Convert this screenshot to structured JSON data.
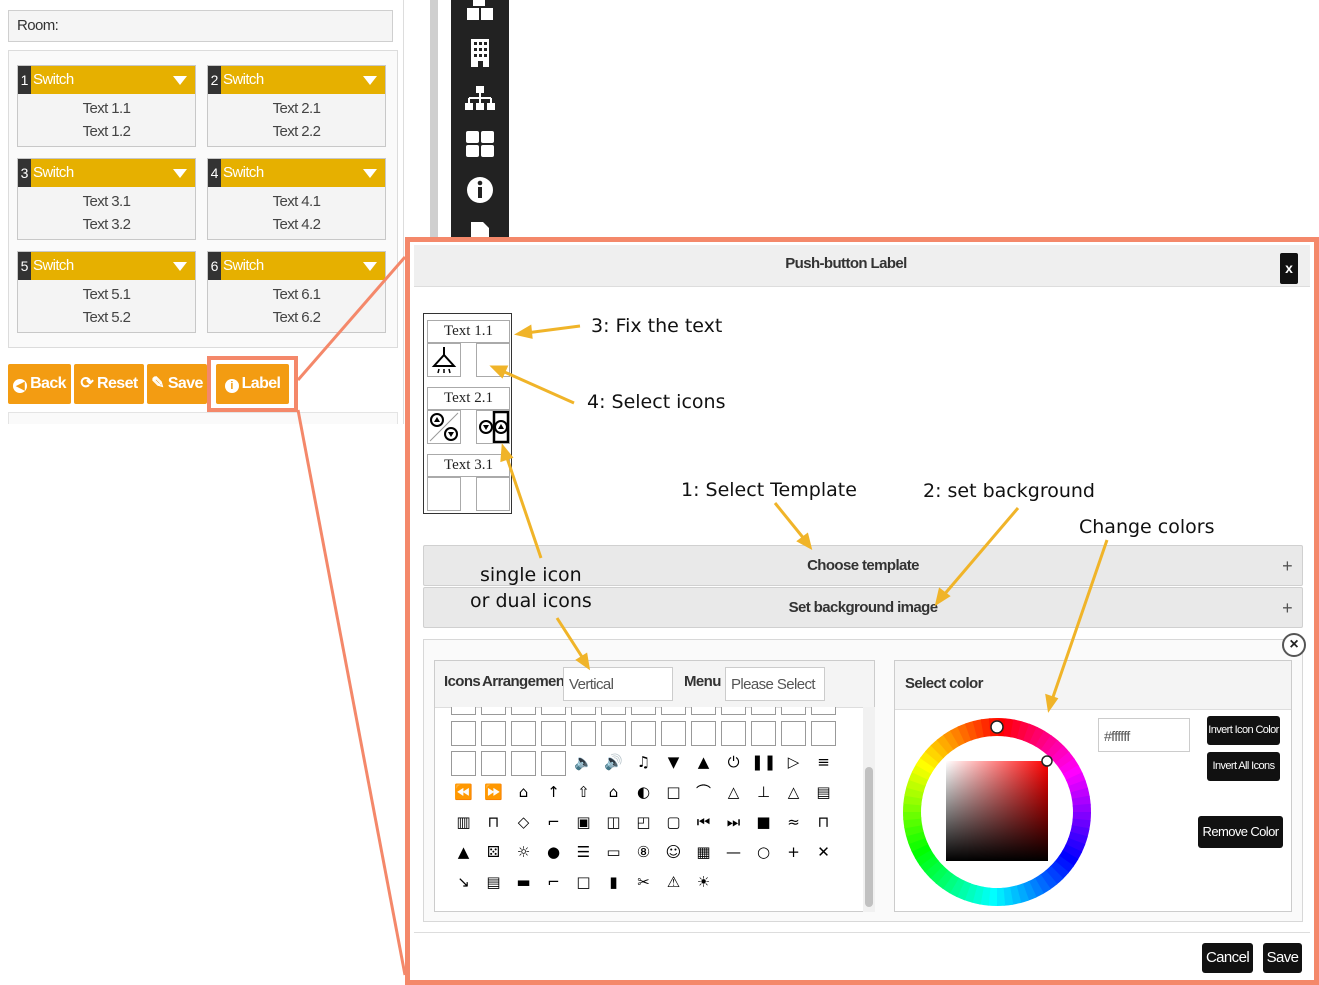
{
  "left": {
    "room_label": "Room:",
    "switches": [
      {
        "num": "1",
        "title": "Switch",
        "t1": "Text 1.1",
        "t2": "Text 1.2"
      },
      {
        "num": "2",
        "title": "Switch",
        "t1": "Text 2.1",
        "t2": "Text 2.2"
      },
      {
        "num": "3",
        "title": "Switch",
        "t1": "Text 3.1",
        "t2": "Text 3.2"
      },
      {
        "num": "4",
        "title": "Switch",
        "t1": "Text 4.1",
        "t2": "Text 4.2"
      },
      {
        "num": "5",
        "title": "Switch",
        "t1": "Text 5.1",
        "t2": "Text 5.2"
      },
      {
        "num": "6",
        "title": "Switch",
        "t1": "Text 6.1",
        "t2": "Text 6.2"
      }
    ],
    "buttons": {
      "back": "Back",
      "reset": "Reset",
      "save": "Save",
      "label": "Label"
    }
  },
  "toolbar_icons": [
    "cubes-icon",
    "building-icon",
    "sitemap-icon",
    "grid-icon",
    "info-icon",
    "file-icon"
  ],
  "dialog": {
    "title": "Push-button Label",
    "close": "x",
    "preview_texts": [
      "Text 1.1",
      "Text 2.1",
      "Text 3.1"
    ],
    "choose_template": "Choose template",
    "set_background": "Set background image",
    "icons_label": "Icons",
    "arrangement_label": "Arrangement",
    "arrangement_value": "Vertical",
    "menu_label": "Menu",
    "menu_placeholder": "Please Select",
    "select_color": "Select color",
    "color_value": "#ffffff",
    "invert_icon_color": "Invert Icon Color",
    "invert_all_icons": "Invert All Icons",
    "remove_color": "Remove Color",
    "cancel": "Cancel",
    "save": "Save"
  },
  "annotations": {
    "fix_text": "3: Fix the text",
    "select_icons": "4: Select icons",
    "select_template": "1: Select Template",
    "set_background": "2: set background",
    "change_colors": "Change colors",
    "single_icon": "single icon",
    "dual_icons": "or dual icons"
  },
  "colors": {
    "accent": "#f39c12",
    "switch_header": "#e6b000",
    "frame": "#f4886a",
    "annotation_arrow": "#f0b429"
  }
}
